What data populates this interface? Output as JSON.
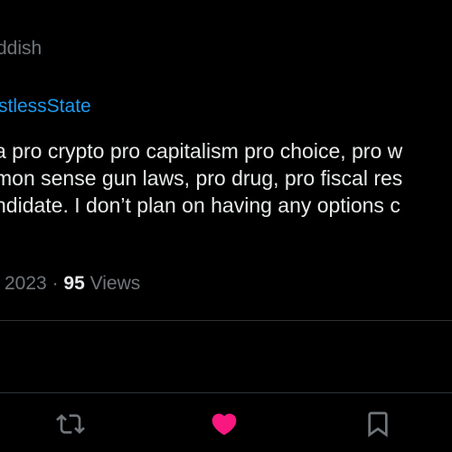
{
  "tweet": {
    "author_name_partial": "ddish",
    "replying_to_partial": "stlessState",
    "text_lines": [
      "a pro crypto pro capitalism pro choice, pro w",
      "mon sense gun laws, pro drug, pro fiscal res",
      "ndidate. I don’t plan on having any options c"
    ],
    "timestamp_partial": "2023",
    "separator": "·",
    "views_count": "95",
    "views_label": "Views"
  },
  "actions": {
    "retweet_icon": "retweet-icon",
    "like_icon": "heart-icon",
    "like_color": "#f91880",
    "bookmark_icon": "bookmark-icon"
  },
  "colors": {
    "background": "#000000",
    "primary_text": "#e7e9ea",
    "secondary_text": "#71767b",
    "link": "#1d9bf0",
    "divider": "#2f3336"
  }
}
